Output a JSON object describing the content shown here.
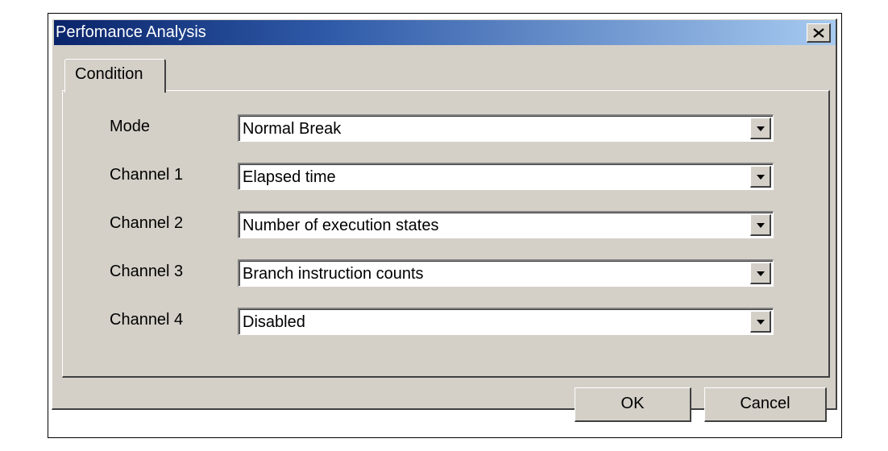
{
  "window": {
    "title": "Perfomance Analysis",
    "close_icon": "close-icon"
  },
  "tabs": [
    {
      "label": "Condition",
      "selected": true
    }
  ],
  "fields": [
    {
      "label": "Mode",
      "value": "Normal Break"
    },
    {
      "label": "Channel 1",
      "value": "Elapsed time"
    },
    {
      "label": "Channel 2",
      "value": "Number of execution states"
    },
    {
      "label": "Channel 3",
      "value": "Branch instruction counts"
    },
    {
      "label": "Channel 4",
      "value": "Disabled"
    }
  ],
  "buttons": {
    "ok_label": "OK",
    "cancel_label": "Cancel"
  },
  "colors": {
    "title_gradient_start": "#0a246a",
    "title_gradient_end": "#a6caf0",
    "dialog_face": "#d4d0c8"
  }
}
